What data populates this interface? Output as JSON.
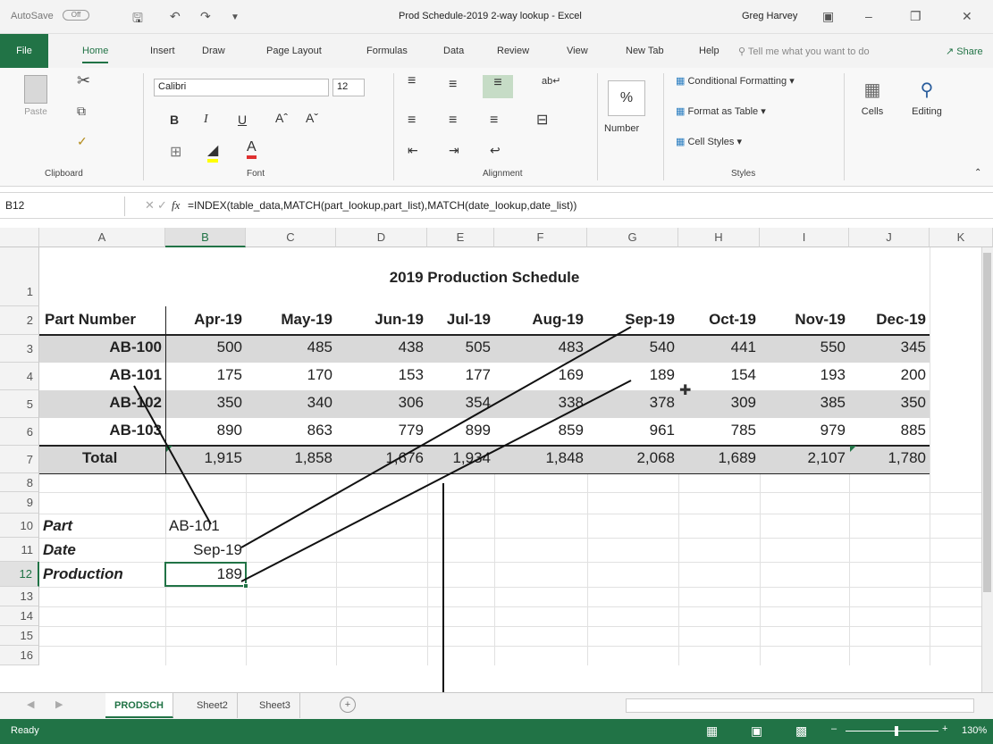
{
  "titlebar": {
    "autosave_label": "AutoSave",
    "autosave_state": "Off",
    "window_title": "Prod Schedule-2019 2-way lookup - Excel",
    "user": "Greg Harvey"
  },
  "tabs": [
    "File",
    "Home",
    "Insert",
    "Draw",
    "Page Layout",
    "Formulas",
    "Data",
    "Review",
    "View",
    "New Tab",
    "Help"
  ],
  "tell_me": "Tell me what you want to do",
  "share_label": "Share",
  "ribbon": {
    "clipboard": {
      "paste": "Paste",
      "label": "Clipboard"
    },
    "font": {
      "name": "Calibri",
      "size": "12",
      "label": "Font",
      "bold": "B",
      "italic": "I",
      "underline": "U"
    },
    "alignment": {
      "label": "Alignment"
    },
    "number": {
      "label": "Number",
      "symbol": "%"
    },
    "styles": {
      "conditional": "Conditional Formatting",
      "format_table": "Format as Table",
      "cell_styles": "Cell Styles",
      "label": "Styles"
    },
    "cells": {
      "label": "Cells"
    },
    "editing": {
      "label": "Editing"
    }
  },
  "formula_bar": {
    "name_box": "B12",
    "fx": "fx",
    "formula": "=INDEX(table_data,MATCH(part_lookup,part_list),MATCH(date_lookup,date_list))"
  },
  "columns": [
    "A",
    "B",
    "C",
    "D",
    "E",
    "F",
    "G",
    "H",
    "I",
    "J",
    "K"
  ],
  "rows": [
    "1",
    "2",
    "3",
    "4",
    "5",
    "6",
    "7",
    "8",
    "9",
    "10",
    "11",
    "12",
    "13",
    "14",
    "15",
    "16"
  ],
  "sheet": {
    "title": "2019 Production Schedule",
    "header_label": "Part Number",
    "months": [
      "Apr-19",
      "May-19",
      "Jun-19",
      "Jul-19",
      "Aug-19",
      "Sep-19",
      "Oct-19",
      "Nov-19",
      "Dec-19"
    ],
    "parts": [
      {
        "name": "AB-100",
        "values": [
          "500",
          "485",
          "438",
          "505",
          "483",
          "540",
          "441",
          "550",
          "345"
        ]
      },
      {
        "name": "AB-101",
        "values": [
          "175",
          "170",
          "153",
          "177",
          "169",
          "189",
          "154",
          "193",
          "200"
        ]
      },
      {
        "name": "AB-102",
        "values": [
          "350",
          "340",
          "306",
          "354",
          "338",
          "378",
          "309",
          "385",
          "350"
        ]
      },
      {
        "name": "AB-103",
        "values": [
          "890",
          "863",
          "779",
          "899",
          "859",
          "961",
          "785",
          "979",
          "885"
        ]
      }
    ],
    "total_label": "Total",
    "totals": [
      "1,915",
      "1,858",
      "1,676",
      "1,934",
      "1,848",
      "2,068",
      "1,689",
      "2,107",
      "1,780"
    ],
    "lookup": {
      "part_label": "Part",
      "part_value": "AB-101",
      "date_label": "Date",
      "date_value": "Sep-19",
      "production_label": "Production",
      "production_value": "189"
    }
  },
  "sheet_tabs": [
    "PRODSCH",
    "Sheet2",
    "Sheet3"
  ],
  "status": {
    "ready": "Ready",
    "zoom": "130%"
  }
}
